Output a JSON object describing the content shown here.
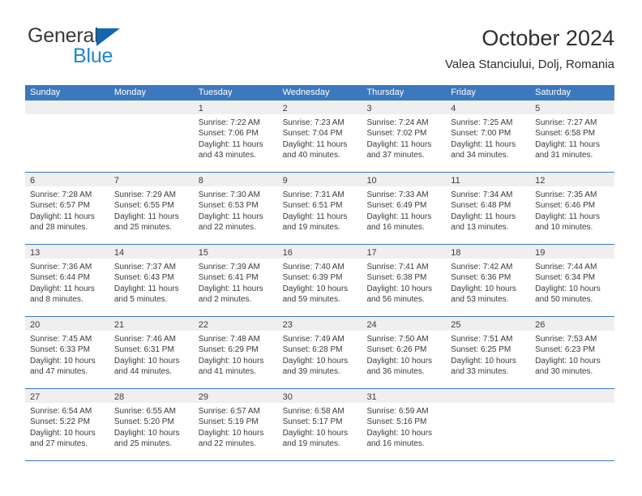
{
  "brand": {
    "name_part1": "General",
    "name_part2": "Blue",
    "logo_icon": "triangle-logo-icon"
  },
  "header": {
    "title": "October 2024",
    "location": "Valea Stanciului, Dolj, Romania"
  },
  "calendar": {
    "weekdays": [
      "Sunday",
      "Monday",
      "Tuesday",
      "Wednesday",
      "Thursday",
      "Friday",
      "Saturday"
    ],
    "accent_color": "#3c78bd",
    "daynumber_bg": "#efefef",
    "weeks": [
      [
        {
          "day": "",
          "lines": []
        },
        {
          "day": "",
          "lines": []
        },
        {
          "day": "1",
          "lines": [
            "Sunrise: 7:22 AM",
            "Sunset: 7:06 PM",
            "Daylight: 11 hours",
            "and 43 minutes."
          ]
        },
        {
          "day": "2",
          "lines": [
            "Sunrise: 7:23 AM",
            "Sunset: 7:04 PM",
            "Daylight: 11 hours",
            "and 40 minutes."
          ]
        },
        {
          "day": "3",
          "lines": [
            "Sunrise: 7:24 AM",
            "Sunset: 7:02 PM",
            "Daylight: 11 hours",
            "and 37 minutes."
          ]
        },
        {
          "day": "4",
          "lines": [
            "Sunrise: 7:25 AM",
            "Sunset: 7:00 PM",
            "Daylight: 11 hours",
            "and 34 minutes."
          ]
        },
        {
          "day": "5",
          "lines": [
            "Sunrise: 7:27 AM",
            "Sunset: 6:58 PM",
            "Daylight: 11 hours",
            "and 31 minutes."
          ]
        }
      ],
      [
        {
          "day": "6",
          "lines": [
            "Sunrise: 7:28 AM",
            "Sunset: 6:57 PM",
            "Daylight: 11 hours",
            "and 28 minutes."
          ]
        },
        {
          "day": "7",
          "lines": [
            "Sunrise: 7:29 AM",
            "Sunset: 6:55 PM",
            "Daylight: 11 hours",
            "and 25 minutes."
          ]
        },
        {
          "day": "8",
          "lines": [
            "Sunrise: 7:30 AM",
            "Sunset: 6:53 PM",
            "Daylight: 11 hours",
            "and 22 minutes."
          ]
        },
        {
          "day": "9",
          "lines": [
            "Sunrise: 7:31 AM",
            "Sunset: 6:51 PM",
            "Daylight: 11 hours",
            "and 19 minutes."
          ]
        },
        {
          "day": "10",
          "lines": [
            "Sunrise: 7:33 AM",
            "Sunset: 6:49 PM",
            "Daylight: 11 hours",
            "and 16 minutes."
          ]
        },
        {
          "day": "11",
          "lines": [
            "Sunrise: 7:34 AM",
            "Sunset: 6:48 PM",
            "Daylight: 11 hours",
            "and 13 minutes."
          ]
        },
        {
          "day": "12",
          "lines": [
            "Sunrise: 7:35 AM",
            "Sunset: 6:46 PM",
            "Daylight: 11 hours",
            "and 10 minutes."
          ]
        }
      ],
      [
        {
          "day": "13",
          "lines": [
            "Sunrise: 7:36 AM",
            "Sunset: 6:44 PM",
            "Daylight: 11 hours",
            "and 8 minutes."
          ]
        },
        {
          "day": "14",
          "lines": [
            "Sunrise: 7:37 AM",
            "Sunset: 6:43 PM",
            "Daylight: 11 hours",
            "and 5 minutes."
          ]
        },
        {
          "day": "15",
          "lines": [
            "Sunrise: 7:39 AM",
            "Sunset: 6:41 PM",
            "Daylight: 11 hours",
            "and 2 minutes."
          ]
        },
        {
          "day": "16",
          "lines": [
            "Sunrise: 7:40 AM",
            "Sunset: 6:39 PM",
            "Daylight: 10 hours",
            "and 59 minutes."
          ]
        },
        {
          "day": "17",
          "lines": [
            "Sunrise: 7:41 AM",
            "Sunset: 6:38 PM",
            "Daylight: 10 hours",
            "and 56 minutes."
          ]
        },
        {
          "day": "18",
          "lines": [
            "Sunrise: 7:42 AM",
            "Sunset: 6:36 PM",
            "Daylight: 10 hours",
            "and 53 minutes."
          ]
        },
        {
          "day": "19",
          "lines": [
            "Sunrise: 7:44 AM",
            "Sunset: 6:34 PM",
            "Daylight: 10 hours",
            "and 50 minutes."
          ]
        }
      ],
      [
        {
          "day": "20",
          "lines": [
            "Sunrise: 7:45 AM",
            "Sunset: 6:33 PM",
            "Daylight: 10 hours",
            "and 47 minutes."
          ]
        },
        {
          "day": "21",
          "lines": [
            "Sunrise: 7:46 AM",
            "Sunset: 6:31 PM",
            "Daylight: 10 hours",
            "and 44 minutes."
          ]
        },
        {
          "day": "22",
          "lines": [
            "Sunrise: 7:48 AM",
            "Sunset: 6:29 PM",
            "Daylight: 10 hours",
            "and 41 minutes."
          ]
        },
        {
          "day": "23",
          "lines": [
            "Sunrise: 7:49 AM",
            "Sunset: 6:28 PM",
            "Daylight: 10 hours",
            "and 39 minutes."
          ]
        },
        {
          "day": "24",
          "lines": [
            "Sunrise: 7:50 AM",
            "Sunset: 6:26 PM",
            "Daylight: 10 hours",
            "and 36 minutes."
          ]
        },
        {
          "day": "25",
          "lines": [
            "Sunrise: 7:51 AM",
            "Sunset: 6:25 PM",
            "Daylight: 10 hours",
            "and 33 minutes."
          ]
        },
        {
          "day": "26",
          "lines": [
            "Sunrise: 7:53 AM",
            "Sunset: 6:23 PM",
            "Daylight: 10 hours",
            "and 30 minutes."
          ]
        }
      ],
      [
        {
          "day": "27",
          "lines": [
            "Sunrise: 6:54 AM",
            "Sunset: 5:22 PM",
            "Daylight: 10 hours",
            "and 27 minutes."
          ]
        },
        {
          "day": "28",
          "lines": [
            "Sunrise: 6:55 AM",
            "Sunset: 5:20 PM",
            "Daylight: 10 hours",
            "and 25 minutes."
          ]
        },
        {
          "day": "29",
          "lines": [
            "Sunrise: 6:57 AM",
            "Sunset: 5:19 PM",
            "Daylight: 10 hours",
            "and 22 minutes."
          ]
        },
        {
          "day": "30",
          "lines": [
            "Sunrise: 6:58 AM",
            "Sunset: 5:17 PM",
            "Daylight: 10 hours",
            "and 19 minutes."
          ]
        },
        {
          "day": "31",
          "lines": [
            "Sunrise: 6:59 AM",
            "Sunset: 5:16 PM",
            "Daylight: 10 hours",
            "and 16 minutes."
          ]
        },
        {
          "day": "",
          "lines": []
        },
        {
          "day": "",
          "lines": []
        }
      ]
    ]
  }
}
